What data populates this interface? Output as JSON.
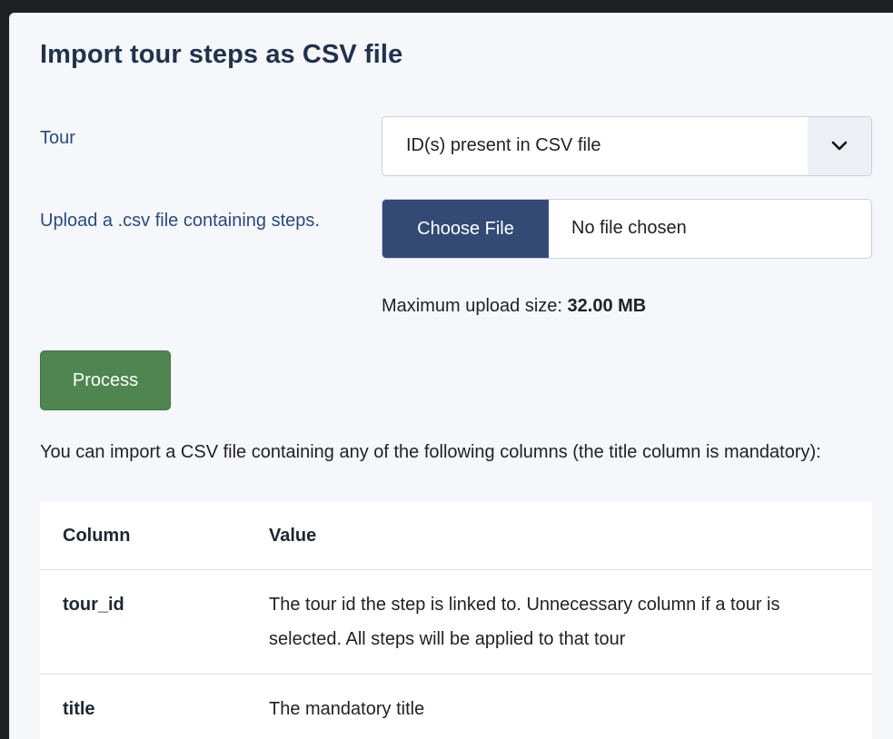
{
  "page": {
    "title": "Import tour steps as CSV file"
  },
  "form": {
    "tour_label": "Tour",
    "tour_select": {
      "selected": "ID(s) present in CSV file",
      "caret_icon": "chevron-down-icon"
    },
    "upload_label": "Upload a .csv file containing steps.",
    "file_input": {
      "button_label": "Choose File",
      "status": "No file chosen"
    },
    "max_upload_prefix": "Maximum upload size: ",
    "max_upload_value": "32.00 MB",
    "process_label": "Process"
  },
  "info": {
    "description": "You can import a CSV file containing any of the following columns (the title column is mandatory):"
  },
  "columns_table": {
    "headers": [
      "Column",
      "Value"
    ],
    "rows": [
      {
        "column": "tour_id",
        "value": "The tour id the step is linked to. Unnecessary column if a tour is selected. All steps will be applied to that tour"
      },
      {
        "column": "title",
        "value": "The mandatory title"
      }
    ]
  },
  "colors": {
    "accent_button": "#334a75",
    "process_button": "#4f8550",
    "label_text": "#2a4a7b",
    "title_text": "#22324d"
  }
}
